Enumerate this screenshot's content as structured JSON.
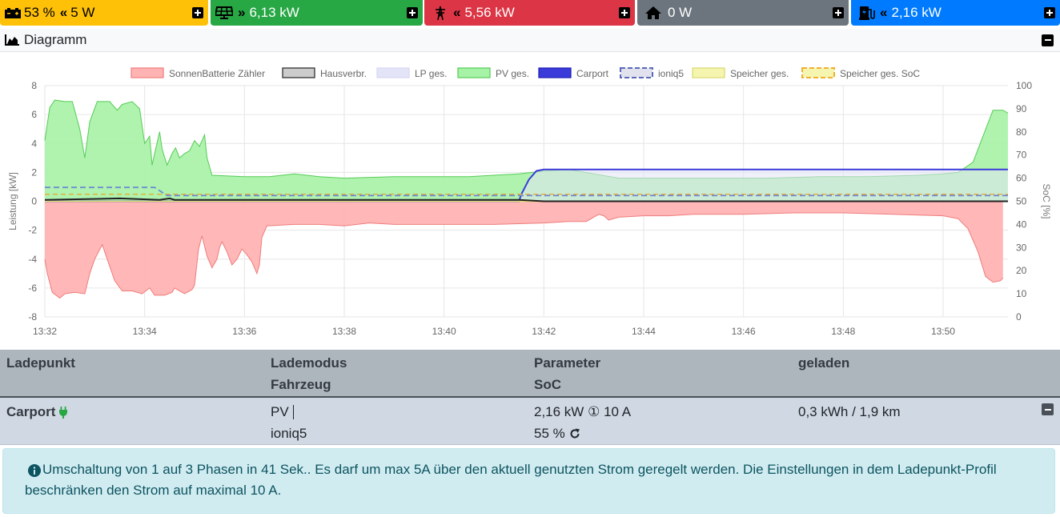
{
  "status": {
    "battery": {
      "value": "53 %",
      "power": "5 W",
      "icon": "battery-icon",
      "color": "#ffc107"
    },
    "pv": {
      "power": "6,13 kW",
      "icon": "solar-panel-icon",
      "color": "#28a745"
    },
    "grid": {
      "power": "5,56 kW",
      "icon": "power-tower-icon",
      "color": "#dc3545"
    },
    "house": {
      "power": "0 W",
      "icon": "home-icon",
      "color": "#6c757d"
    },
    "chargepoint": {
      "power": "2,16 kW",
      "icon": "charging-station-icon",
      "color": "#007bff"
    }
  },
  "diagram": {
    "title": "Diagramm"
  },
  "chart_data": {
    "type": "area",
    "title": "",
    "ylabel": "Leistung [kW]",
    "y2label": "SoC [%]",
    "ylim": [
      -8,
      8
    ],
    "y2lim": [
      0,
      100
    ],
    "yticks": [
      "8",
      "6",
      "4",
      "2",
      "0",
      "-2",
      "-4",
      "-6",
      "-8"
    ],
    "y2ticks": [
      "100",
      "90",
      "80",
      "70",
      "60",
      "50",
      "40",
      "30",
      "20",
      "10",
      "0"
    ],
    "xticks": [
      "13:32",
      "13:34",
      "13:36",
      "13:38",
      "13:40",
      "13:42",
      "13:44",
      "13:46",
      "13:48",
      "13:50"
    ],
    "grid": true,
    "legend_position": "top",
    "legend": [
      {
        "label": "SonnenBatterie Zähler",
        "fill": "#ffb3b3",
        "stroke": "#f07c7c",
        "dash": false
      },
      {
        "label": "Hausverbr.",
        "fill": "#cccccc",
        "stroke": "#222222",
        "dash": false
      },
      {
        "label": "LP ges.",
        "fill": "#e4e4f8",
        "stroke": "#d6d6f2",
        "dash": false
      },
      {
        "label": "PV ges.",
        "fill": "#a6f2a6",
        "stroke": "#55cc55",
        "dash": false
      },
      {
        "label": "Carport",
        "fill": "#3b3bd9",
        "stroke": "#1b1bb5",
        "dash": false
      },
      {
        "label": "ioniq5",
        "fill": "#e2e2ee",
        "stroke": "#5a6ab8",
        "dash": true
      },
      {
        "label": "Speicher ges.",
        "fill": "#f5f5b0",
        "stroke": "#d8d870",
        "dash": false
      },
      {
        "label": "Speicher ges. SoC",
        "fill": "#f5f5b0",
        "stroke": "#f0b030",
        "dash": true
      }
    ],
    "series": [
      {
        "name": "PV ges.",
        "unit": "kW",
        "points": [
          [
            0,
            4.2
          ],
          [
            0.1,
            6.5
          ],
          [
            0.2,
            7.0
          ],
          [
            0.4,
            6.9
          ],
          [
            0.55,
            6.9
          ],
          [
            0.7,
            5.0
          ],
          [
            0.8,
            3.0
          ],
          [
            0.9,
            5.5
          ],
          [
            1.05,
            6.9
          ],
          [
            1.3,
            6.9
          ],
          [
            1.45,
            6.3
          ],
          [
            1.55,
            6.7
          ],
          [
            1.75,
            6.9
          ],
          [
            1.9,
            6.4
          ],
          [
            2.0,
            4.0
          ],
          [
            2.1,
            4.5
          ],
          [
            2.15,
            2.5
          ],
          [
            2.2,
            3.3
          ],
          [
            2.3,
            4.8
          ],
          [
            2.35,
            3.6
          ],
          [
            2.45,
            2.5
          ],
          [
            2.55,
            3.3
          ],
          [
            2.62,
            3.7
          ],
          [
            2.7,
            3.0
          ],
          [
            2.8,
            3.3
          ],
          [
            2.9,
            3.5
          ],
          [
            3.0,
            4.2
          ],
          [
            3.1,
            3.8
          ],
          [
            3.2,
            4.6
          ],
          [
            3.25,
            3.0
          ],
          [
            3.35,
            1.8
          ],
          [
            4.0,
            1.7
          ],
          [
            4.5,
            1.7
          ],
          [
            5.0,
            1.9
          ],
          [
            5.5,
            1.7
          ],
          [
            6.0,
            1.6
          ],
          [
            7.0,
            1.7
          ],
          [
            8.5,
            1.7
          ],
          [
            9.5,
            1.9
          ],
          [
            10.0,
            2.1
          ],
          [
            10.5,
            2.2
          ],
          [
            11.0,
            1.9
          ],
          [
            11.5,
            1.6
          ],
          [
            12.5,
            1.6
          ],
          [
            13.5,
            1.6
          ],
          [
            14.5,
            1.6
          ],
          [
            15.5,
            1.7
          ],
          [
            16.5,
            1.7
          ],
          [
            17.5,
            1.8
          ],
          [
            18.0,
            1.9
          ],
          [
            18.3,
            2.0
          ],
          [
            18.6,
            2.7
          ],
          [
            18.8,
            4.5
          ],
          [
            19.0,
            6.3
          ],
          [
            19.2,
            6.3
          ],
          [
            19.3,
            6.1
          ]
        ]
      },
      {
        "name": "SonnenBatterie Zähler",
        "unit": "kW",
        "points": [
          [
            0,
            -4.0
          ],
          [
            0.05,
            -5.0
          ],
          [
            0.15,
            -6.3
          ],
          [
            0.3,
            -6.7
          ],
          [
            0.4,
            -6.4
          ],
          [
            0.6,
            -6.3
          ],
          [
            0.8,
            -6.4
          ],
          [
            0.9,
            -5.0
          ],
          [
            1.0,
            -4.0
          ],
          [
            1.15,
            -3.0
          ],
          [
            1.25,
            -4.0
          ],
          [
            1.4,
            -5.5
          ],
          [
            1.55,
            -6.2
          ],
          [
            1.75,
            -6.2
          ],
          [
            1.95,
            -6.4
          ],
          [
            2.1,
            -6.0
          ],
          [
            2.2,
            -6.5
          ],
          [
            2.4,
            -6.5
          ],
          [
            2.55,
            -6.3
          ],
          [
            2.6,
            -6.0
          ],
          [
            2.8,
            -6.4
          ],
          [
            2.95,
            -6.1
          ],
          [
            3.0,
            -5.8
          ],
          [
            3.08,
            -3.3
          ],
          [
            3.15,
            -2.4
          ],
          [
            3.25,
            -3.8
          ],
          [
            3.35,
            -4.6
          ],
          [
            3.45,
            -4.0
          ],
          [
            3.5,
            -3.2
          ],
          [
            3.55,
            -2.8
          ],
          [
            3.65,
            -3.5
          ],
          [
            3.75,
            -4.4
          ],
          [
            3.85,
            -4.0
          ],
          [
            3.95,
            -3.3
          ],
          [
            4.05,
            -3.7
          ],
          [
            4.15,
            -4.2
          ],
          [
            4.25,
            -5.0
          ],
          [
            4.3,
            -4.4
          ],
          [
            4.35,
            -2.5
          ],
          [
            4.45,
            -1.7
          ],
          [
            5.0,
            -1.6
          ],
          [
            5.5,
            -1.6
          ],
          [
            6.0,
            -1.7
          ],
          [
            6.5,
            -1.5
          ],
          [
            7.0,
            -1.6
          ],
          [
            8.0,
            -1.6
          ],
          [
            9.0,
            -1.6
          ],
          [
            10.0,
            -1.5
          ],
          [
            10.5,
            -1.4
          ],
          [
            10.85,
            -1.4
          ],
          [
            10.95,
            -1.2
          ],
          [
            11.1,
            -0.9
          ],
          [
            11.2,
            -1.0
          ],
          [
            11.3,
            -1.3
          ],
          [
            11.5,
            -1.1
          ],
          [
            12.0,
            -1.0
          ],
          [
            12.5,
            -1.0
          ],
          [
            13.0,
            -0.9
          ],
          [
            14.0,
            -0.9
          ],
          [
            15.0,
            -0.8
          ],
          [
            16.0,
            -0.8
          ],
          [
            17.0,
            -0.9
          ],
          [
            18.0,
            -1.0
          ],
          [
            18.3,
            -1.2
          ],
          [
            18.5,
            -1.9
          ],
          [
            18.7,
            -3.5
          ],
          [
            18.85,
            -5.2
          ],
          [
            19.0,
            -5.6
          ],
          [
            19.15,
            -5.5
          ],
          [
            19.2,
            -5.3
          ]
        ]
      },
      {
        "name": "LP ges.",
        "unit": "kW",
        "points": [
          [
            0,
            0
          ],
          [
            9.5,
            0
          ],
          [
            9.55,
            0.5
          ],
          [
            9.7,
            1.5
          ],
          [
            9.85,
            2.1
          ],
          [
            10.0,
            2.2
          ],
          [
            19.3,
            2.2
          ]
        ]
      },
      {
        "name": "Carport",
        "unit": "kW",
        "points": [
          [
            0,
            0
          ],
          [
            9.5,
            0
          ],
          [
            9.55,
            0.5
          ],
          [
            9.7,
            1.5
          ],
          [
            9.85,
            2.1
          ],
          [
            10.0,
            2.2
          ],
          [
            19.3,
            2.2
          ]
        ]
      },
      {
        "name": "Hausverbr.",
        "unit": "kW",
        "points": [
          [
            0,
            0.1
          ],
          [
            1.5,
            0.2
          ],
          [
            2.3,
            0.1
          ],
          [
            2.5,
            0.2
          ],
          [
            2.6,
            0.1
          ],
          [
            3.0,
            0.1
          ],
          [
            5.0,
            0.1
          ],
          [
            9.5,
            0.1
          ],
          [
            10.0,
            0.0
          ],
          [
            19.3,
            0.0
          ]
        ]
      },
      {
        "name": "Speicher ges.",
        "unit": "kW",
        "points": [
          [
            0,
            0.0
          ],
          [
            19.3,
            0.0
          ]
        ]
      },
      {
        "name": "ioniq5",
        "unit": "%",
        "points": [
          [
            0,
            56
          ],
          [
            2.2,
            56
          ],
          [
            2.45,
            52.5
          ],
          [
            19.3,
            52.5
          ]
        ]
      },
      {
        "name": "Speicher ges. SoC",
        "unit": "%",
        "points": [
          [
            0,
            53
          ],
          [
            19.3,
            53
          ]
        ]
      }
    ]
  },
  "lp_table": {
    "headers": {
      "col1": "Ladepunkt",
      "col2a": "Lademodus",
      "col2b": "Fahrzeug",
      "col3a": "Parameter",
      "col3b": "SoC",
      "col4": "geladen"
    },
    "row": {
      "name": "Carport",
      "mode": "PV",
      "vehicle": "ioniq5",
      "power": "2,16 kW",
      "phases": "①",
      "current": "10 A",
      "soc": "55 %",
      "charged": "0,3 kWh / 1,9 km",
      "plug_color": "#28a745"
    }
  },
  "alert": {
    "text": "Umschaltung von 1 auf 3 Phasen in 41 Sek.. Es darf um max 5A über den aktuell genutzten Strom geregelt werden. Die Einstellungen in dem Ladepunkt-Profil beschränken den Strom auf maximal 10 A."
  }
}
